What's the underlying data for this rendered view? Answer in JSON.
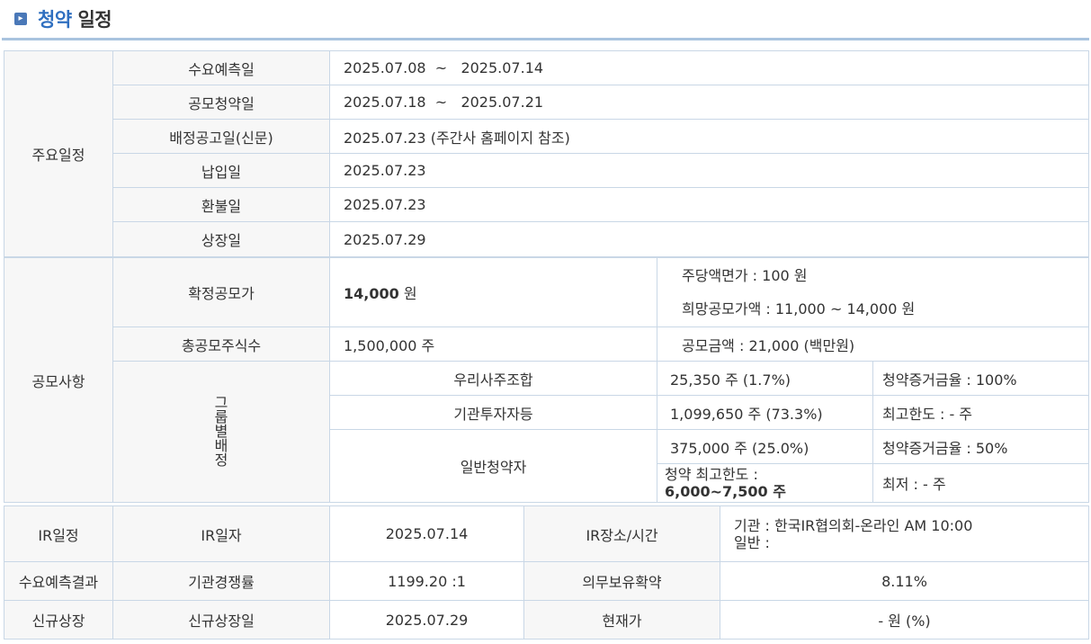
{
  "page": {
    "title_accent": "청약",
    "title_rest": "일정",
    "title_icon": "arrow-box-icon"
  },
  "schedule": {
    "section_label": "주요일정",
    "rows": [
      {
        "label": "수요예측일",
        "value": "2025.07.08  ~   2025.07.14"
      },
      {
        "label": "공모청약일",
        "value": "2025.07.18  ~   2025.07.21"
      },
      {
        "label": "배정공고일(신문)",
        "value": "2025.07.23 (주간사 홈페이지 참조)"
      },
      {
        "label": "납입일",
        "value": "2025.07.23"
      },
      {
        "label": "환불일",
        "value": "2025.07.23"
      },
      {
        "label": "상장일",
        "value": "2025.07.29"
      }
    ]
  },
  "offering": {
    "section_label": "공모사항",
    "fixed_price_label": "확정공모가",
    "fixed_price_value": "14,000",
    "fixed_price_unit": "원",
    "par_value": "주당액면가 :  100 원",
    "desired_price": "희망공모가액 :  11,000 ~ 14,000 원",
    "total_shares_label": "총공모주식수",
    "total_shares_value": "1,500,000 주",
    "offering_amount": "공모금액 : 21,000 (백만원)",
    "group_label": "그룹별배정",
    "groups": [
      {
        "name": "우리사주조합",
        "shares": "25,350 주  (1.7%)",
        "note": "청약증거금율 : 100%"
      },
      {
        "name": "기관투자자등",
        "shares": "1,099,650 주  (73.3%)",
        "note": "최고한도 :  - 주"
      },
      {
        "name": "일반청약자",
        "shares": "375,000 주  (25.0%)",
        "note": "청약증거금율 : 50%",
        "max_label": "청약 최고한도 :",
        "max_value": "6,000~7,500 주",
        "min_note": "최저 :  - 주"
      }
    ]
  },
  "ir": {
    "section_label": "IR일정",
    "date_label": "IR일자",
    "date_value": "2025.07.14",
    "place_label": "IR장소/시간",
    "place_line1": "기관 : 한국IR협의회-온라인 AM 10:00",
    "place_line2": "일반 :"
  },
  "demand": {
    "section_label": "수요예측결과",
    "competition_label": "기관경쟁률",
    "competition_value": "1199.20 :1",
    "lockup_label": "의무보유확약",
    "lockup_value": "8.11%"
  },
  "listing": {
    "section_label": "신규상장",
    "date_label": "신규상장일",
    "date_value": "2025.07.29",
    "price_label": "현재가",
    "price_value": "- 원 (%)"
  }
}
